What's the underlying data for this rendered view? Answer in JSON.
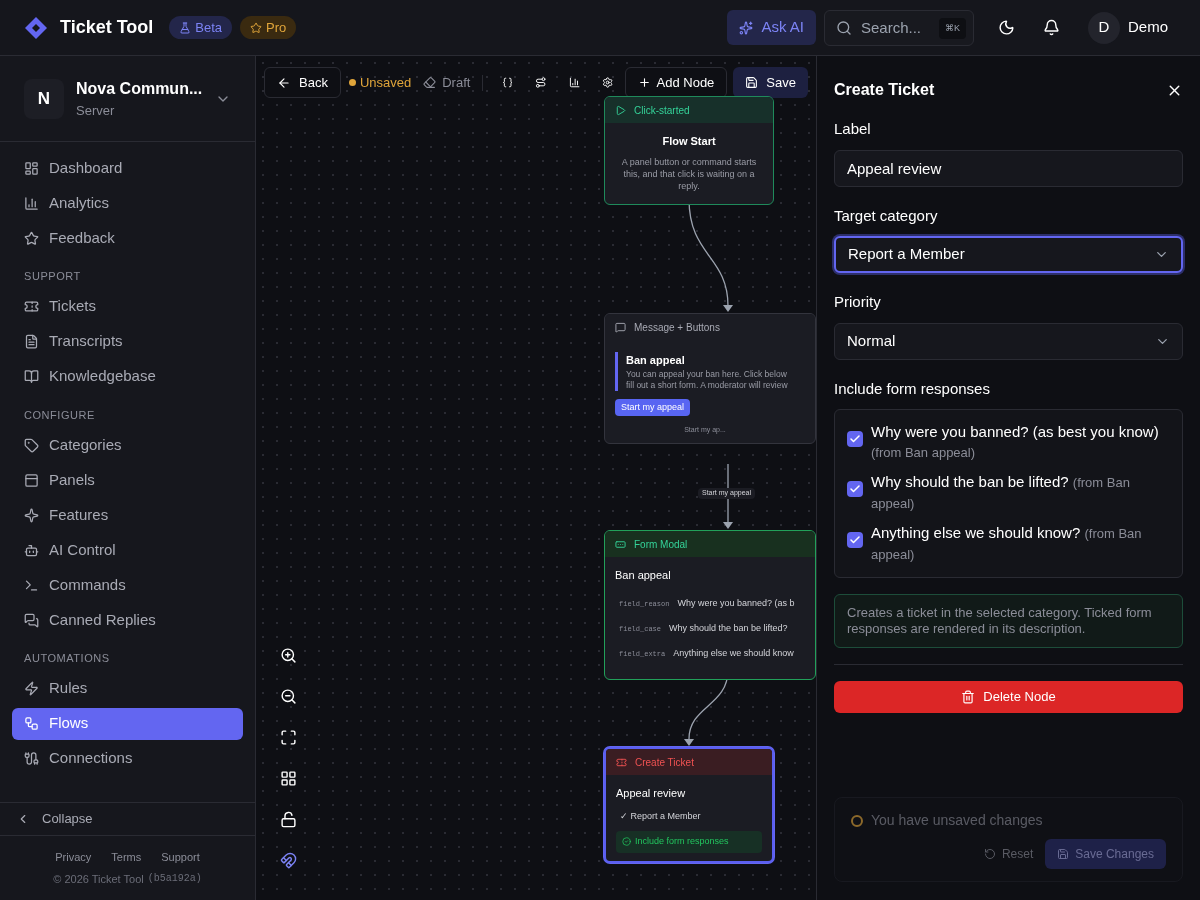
{
  "header": {
    "title": "Ticket Tool",
    "badges": [
      {
        "label": "Beta",
        "kind": "beta"
      },
      {
        "label": "Pro",
        "kind": "pro"
      }
    ],
    "ask_ai": "Ask AI",
    "search": {
      "placeholder": "Search...",
      "shortcut": "⌘K"
    },
    "user": {
      "initial": "D",
      "name": "Demo"
    }
  },
  "sidebar": {
    "server": {
      "initial": "N",
      "name": "Nova Commun...",
      "subtitle": "Server"
    },
    "sections": [
      {
        "items": [
          {
            "label": "Dashboard",
            "selected": false
          },
          {
            "label": "Analytics",
            "selected": false
          },
          {
            "label": "Feedback",
            "selected": false
          }
        ]
      },
      {
        "heading": "SUPPORT",
        "items": [
          {
            "label": "Tickets",
            "selected": false
          },
          {
            "label": "Transcripts",
            "selected": false
          },
          {
            "label": "Knowledgebase",
            "selected": false
          }
        ]
      },
      {
        "heading": "CONFIGURE",
        "items": [
          {
            "label": "Categories",
            "selected": false
          },
          {
            "label": "Panels",
            "selected": false
          },
          {
            "label": "Features",
            "selected": false
          },
          {
            "label": "AI Control",
            "selected": false
          },
          {
            "label": "Commands",
            "selected": false
          },
          {
            "label": "Canned Replies",
            "selected": false
          }
        ]
      },
      {
        "heading": "AUTOMATIONS",
        "items": [
          {
            "label": "Rules",
            "selected": false
          },
          {
            "label": "Flows",
            "selected": true
          },
          {
            "label": "Connections",
            "selected": false
          }
        ]
      }
    ],
    "collapse": "Collapse",
    "footer_links": [
      "Privacy",
      "Terms",
      "Support"
    ],
    "copyright": "© 2026 Ticket Tool",
    "build": "(b5a192a)"
  },
  "toolbar": {
    "back": "Back",
    "status": "Unsaved",
    "draft": "Draft",
    "add_node": "Add Node",
    "save": "Save"
  },
  "nodes": [
    {
      "kind": "start",
      "header": "Click-started",
      "title": "Flow Start",
      "text": "A panel button or command starts this, and that click is waiting on a reply.",
      "selected": false
    },
    {
      "kind": "message",
      "header": "Message + Buttons",
      "title": "Ban appeal",
      "lines": [
        "You can appeal your ban here. Click below",
        "fill out a short form. A moderator will review"
      ],
      "button": "Start my appeal",
      "footer": "Start my ap...",
      "selected": false
    },
    {
      "kind": "form",
      "header": "Form Modal",
      "title": "Ban appeal",
      "fields": [
        {
          "id": "field_reason",
          "label": "Why were you banned? (as b"
        },
        {
          "id": "field_case",
          "label": "Why should the ban be lifted?"
        },
        {
          "id": "field_extra",
          "label": "Anything else we should know"
        }
      ],
      "selected": false
    },
    {
      "kind": "ticket",
      "header": "Create Ticket",
      "title": "Appeal review",
      "category": "✓ Report a Member",
      "responses": "Include form responses",
      "selected": true
    }
  ],
  "edge_label": "Start my appeal",
  "panel": {
    "title": "Create Ticket",
    "label": {
      "label": "Label",
      "value": "Appeal review"
    },
    "category": {
      "label": "Target category",
      "value": "Report a Member",
      "focused": true
    },
    "priority": {
      "label": "Priority",
      "value": "Normal",
      "focused": false
    },
    "responses_label": "Include form responses",
    "responses": [
      {
        "question": "Why were you banned? (as best you know)",
        "source": "(from Ban appeal)",
        "checked": true
      },
      {
        "question": "Why should the ban be lifted?",
        "source": "(from Ban appeal)",
        "checked": true
      },
      {
        "question": "Anything else we should know?",
        "source": "(from Ban appeal)",
        "checked": true
      }
    ],
    "info": "Creates a ticket in the selected category. Ticked form responses are rendered in its description.",
    "delete": "Delete Node"
  },
  "toast": {
    "message": "You have unsaved changes",
    "reset": "Reset",
    "save": "Save Changes"
  }
}
